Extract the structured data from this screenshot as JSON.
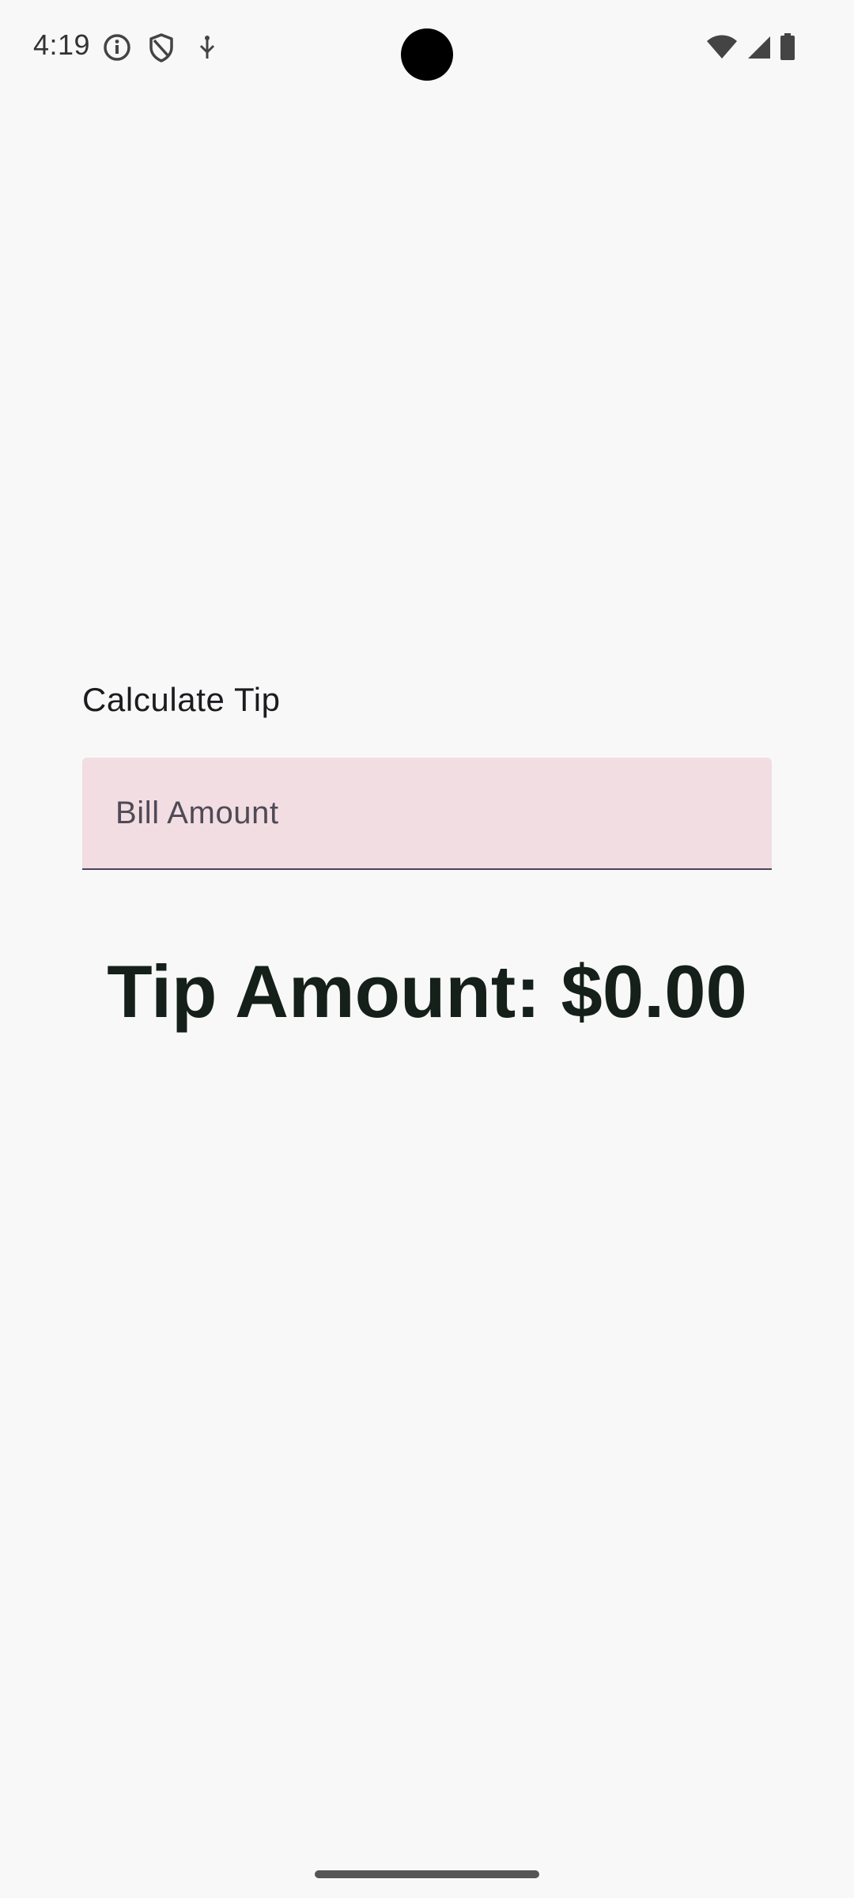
{
  "status_bar": {
    "time": "4:19",
    "left_icons": [
      "info-icon",
      "shield-icon",
      "usb-debug-icon"
    ],
    "right_icons": [
      "wifi-icon",
      "cellular-signal-icon",
      "battery-icon"
    ]
  },
  "app": {
    "title": "Calculate Tip",
    "bill_input": {
      "placeholder": "Bill Amount",
      "value": ""
    },
    "tip_amount_text": "Tip Amount: $0.00"
  },
  "colors": {
    "background": "#f8f8f8",
    "input_background": "#f2dde3",
    "input_underline": "#4a4458",
    "tip_text": "#142019"
  }
}
